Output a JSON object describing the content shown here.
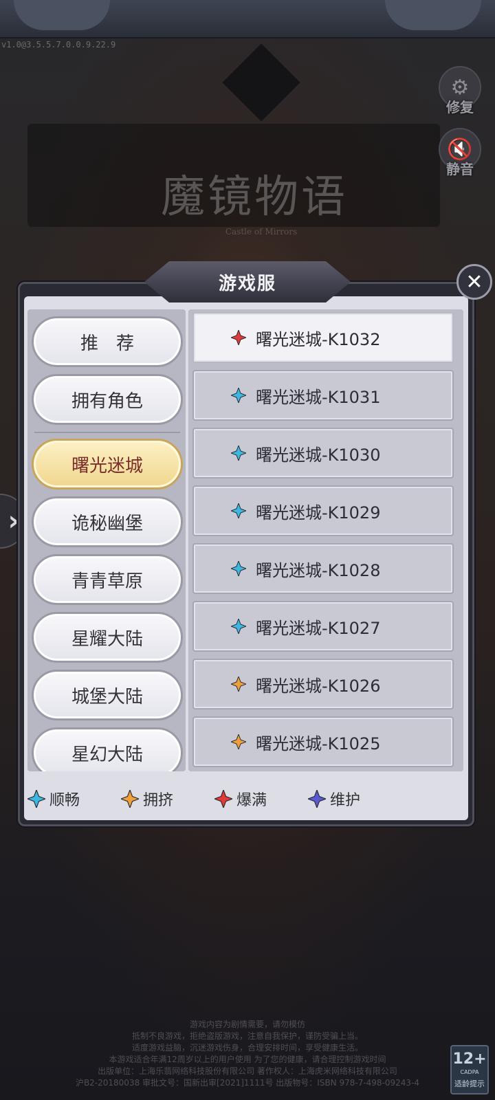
{
  "version": "v1.0@3.5.5.7.0.0.9.22.9",
  "logo": {
    "title": "魔镜物语",
    "subtitle": "Castle of Mirrors"
  },
  "side_buttons": {
    "repair": "修复",
    "mute": "静音"
  },
  "dialog": {
    "title": "游戏服",
    "categories": [
      {
        "label": "推　荐",
        "active": false
      },
      {
        "label": "拥有角色",
        "active": false
      },
      {
        "label": "曙光迷城",
        "active": true
      },
      {
        "label": "诡秘幽堡",
        "active": false
      },
      {
        "label": "青青草原",
        "active": false
      },
      {
        "label": "星耀大陆",
        "active": false
      },
      {
        "label": "城堡大陆",
        "active": false
      },
      {
        "label": "星幻大陆",
        "active": false
      }
    ],
    "servers": [
      {
        "name": "曙光迷城-K1032",
        "status": "爆满",
        "color": "#e03b36"
      },
      {
        "name": "曙光迷城-K1031",
        "status": "顺畅",
        "color": "#3bb7e0"
      },
      {
        "name": "曙光迷城-K1030",
        "status": "顺畅",
        "color": "#3bb7e0"
      },
      {
        "name": "曙光迷城-K1029",
        "status": "顺畅",
        "color": "#3bb7e0"
      },
      {
        "name": "曙光迷城-K1028",
        "status": "顺畅",
        "color": "#3bb7e0"
      },
      {
        "name": "曙光迷城-K1027",
        "status": "顺畅",
        "color": "#3bb7e0"
      },
      {
        "name": "曙光迷城-K1026",
        "status": "拥挤",
        "color": "#f0a03a"
      },
      {
        "name": "曙光迷城-K1025",
        "status": "拥挤",
        "color": "#f0a03a"
      }
    ],
    "legend": [
      {
        "label": "顺畅",
        "color": "#3bb7e0"
      },
      {
        "label": "拥挤",
        "color": "#f0a03a"
      },
      {
        "label": "爆满",
        "color": "#e03b36"
      },
      {
        "label": "维护",
        "color": "#5a5ad0"
      }
    ]
  },
  "footer": {
    "lines": [
      "游戏内容为剧情需要，请勿模仿",
      "抵制不良游戏，拒绝盗版游戏，注意自我保护，谨防受骗上当。",
      "适度游戏益脑，沉迷游戏伤身，合理安排时间，享受健康生活。",
      "本游戏适合年满12周岁以上的用户使用 为了您的健康，请合理控制游戏时间",
      "出版单位：上海乐翡网络科技股份有限公司 著作权人：上海虎米网络科技有限公司",
      "沪B2-20180038 审批文号：国新出审[2021]1111号 出版物号：ISBN 978-7-498-09243-4"
    ],
    "age_rating": "12+",
    "age_org": "CADPA",
    "age_tip": "适龄提示"
  }
}
